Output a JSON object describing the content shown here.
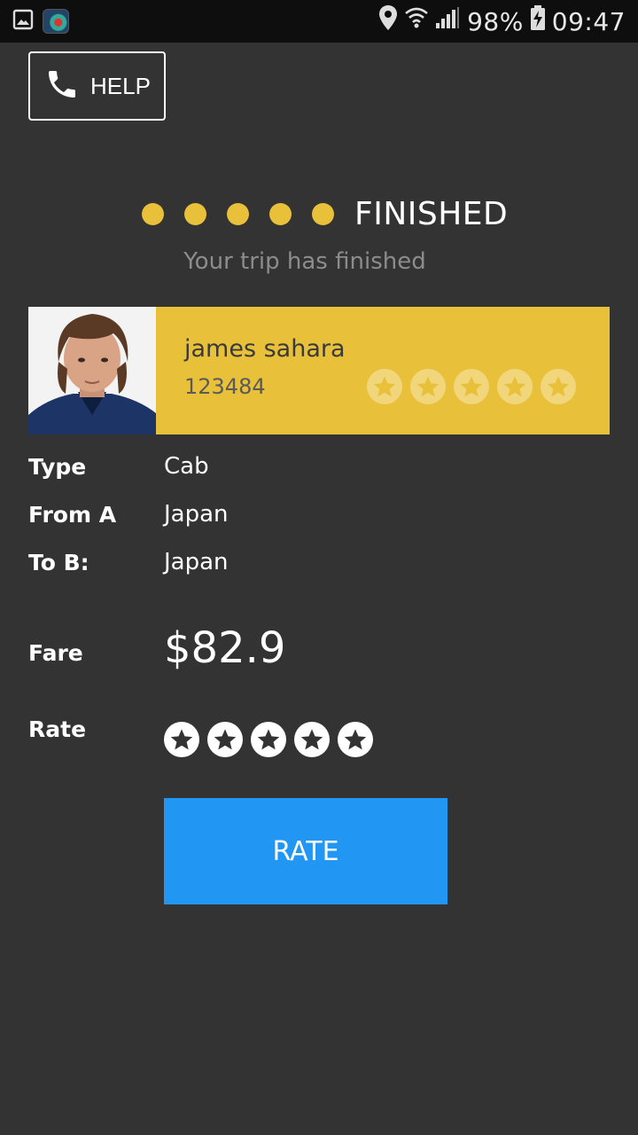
{
  "status_bar": {
    "battery_percent": "98%",
    "time": "09:47",
    "icons": [
      "gallery-icon",
      "app-notification-icon",
      "location-icon",
      "wifi-icon",
      "signal-icon",
      "battery-charging-icon"
    ]
  },
  "help_button": {
    "label": "HELP",
    "icon": "phone-icon"
  },
  "progress": {
    "steps_completed": 5,
    "status_label": "FINISHED",
    "subtitle": "Your trip has finished",
    "dot_color": "#e9c03a"
  },
  "driver": {
    "name": "james sahara",
    "id": "123484",
    "rating_stars": 5,
    "card_color": "#e9c03a"
  },
  "trip": {
    "type_label": "Type",
    "type_value": "Cab",
    "from_label": "From A",
    "from_value": "Japan",
    "to_label": "To B:",
    "to_value": "Japan",
    "fare_label": "Fare",
    "fare_value": "$82.9",
    "rate_label": "Rate",
    "rate_stars": 5
  },
  "rate_button": {
    "label": "RATE",
    "color": "#2196f3"
  }
}
